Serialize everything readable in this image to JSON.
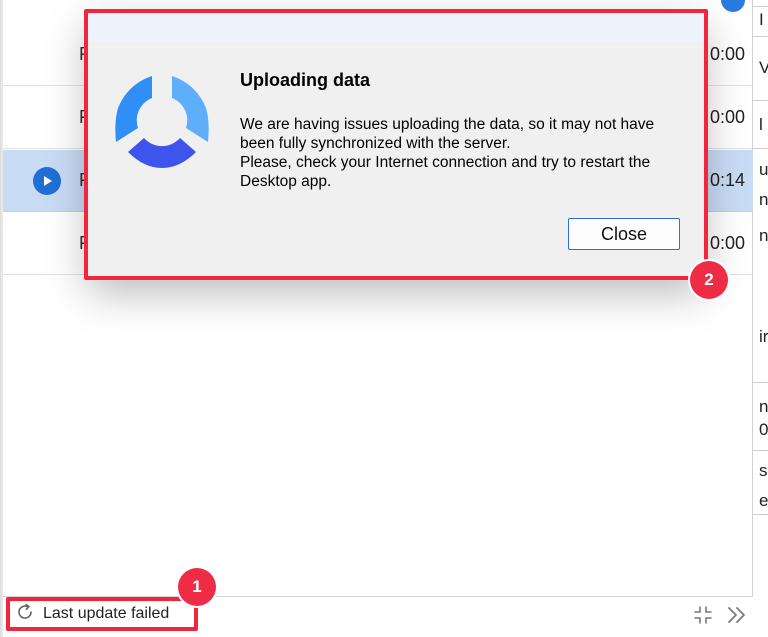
{
  "list": {
    "rows": [
      {
        "name": "F",
        "time": "0:00"
      },
      {
        "name": "F",
        "time": "0:00"
      },
      {
        "name": "F",
        "time": "0:14"
      },
      {
        "name": "F",
        "time": "0:00"
      }
    ]
  },
  "right_panel": {
    "fragments": [
      "I",
      "V",
      "l",
      "u",
      "ne",
      "ne",
      "ir",
      "na",
      "0",
      "s",
      "e"
    ]
  },
  "footer": {
    "status_label": "Last update failed"
  },
  "dialog": {
    "title": "Uploading data",
    "message_line1": "We are having issues uploading the data, so it may not have been fully synchronized with the server.",
    "message_line2": "Please, check your Internet connection and try to restart the Desktop app.",
    "close_label": "Close"
  },
  "annotations": {
    "marker_1": "1",
    "marker_2": "2"
  },
  "colors": {
    "accent": "#1f6fd6",
    "selected_row": "#c9dcf5",
    "annotation": "#ee2c46",
    "logo_light": "#5eaefc",
    "logo_dark": "#3d55ec"
  }
}
